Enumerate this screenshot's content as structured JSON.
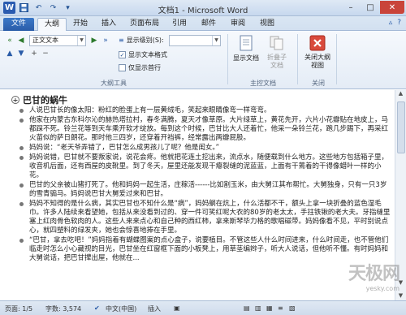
{
  "window": {
    "title": "文档1 - Microsoft Word"
  },
  "tabs": [
    {
      "label": "文件"
    },
    {
      "label": "大纲"
    },
    {
      "label": "开始"
    },
    {
      "label": "插入"
    },
    {
      "label": "页面布局"
    },
    {
      "label": "引用"
    },
    {
      "label": "邮件"
    },
    {
      "label": "审阅"
    },
    {
      "label": "视图"
    }
  ],
  "ribbon": {
    "outline_tools": {
      "level_value": "正文文本",
      "show_level_label": "显示级别(S):",
      "show_text_format_label": "显示文本格式",
      "show_first_line_label": "仅显示首行",
      "group_label": "大纲工具"
    },
    "master_doc": {
      "show_doc_label": "显示文档",
      "collapse_subdoc_label": "折叠子文档",
      "group_label": "主控文档"
    },
    "close": {
      "close_label": "关闭大纲视图",
      "group_label": "关闭"
    }
  },
  "document": {
    "heading": "巴甘的蜗牛",
    "paragraphs": [
      "人说巴甘长的像太阳：粉红的脸蛋上有一层黄绒毛，笑起来眼睛像弯一样弯弯。",
      "他家在内蒙古东科尔沁的赫热塔拉村，春冬满腾，夏天才像草原。大片绿草上，黄花先开，六片小花瓣贴在地皮上，马都踩不死。铃兰花等到天车乘开软才绽放。每到这个时候，巴甘比大人还着忙，他采一朵铃兰花，跑几步踢下，再采红火苗似的萨日朗花。那时他三四岁，还穿着开裆裤，经常露出两瓣屁股。",
      "妈妈说：“老天爷弄错了，巴甘怎么成男孩儿了呢？他是闺女。”",
      "妈妈说错，巴甘就不要叛家说，说花会疼。他就把花连土挖出来，流点水，随便载到什么地方。这些地方包括箱子里，收音机后面，还有西屋的皮靴里。到了冬天，屋里还能发现干瘪裂缝的泥蓝蓝，上面有干蔫着的干得像蜡叶一样的小花。",
      "巴甘的父亲被山猪打死了。他和妈妈一起生活，庄稼活------比如割玉米，由大舅江其布帮忙。大舅独身，只有一只3岁的雪青骟马。妈妈说巴甘大舅爱过来和巴甘。",
      "妈妈不知得的是什么病，其实巴甘也不知什么是“病”，妈妈躺在炕上，什么活都不干，额头上拿一块折叠的蓝色湿毛巾。许多人陆续来看望她，包括从来没看到过的、穿一件可笑红呢大衣的80岁的老太太，手拄铁锹的老大夫。牙指缝里塞上红肉骨色软肉的人。这些人来来点心和自己种的西红柿，拿来斯琴毕力格的歌唱磁带。妈妈像看不见，平时别说点心，就四塑料的绿发夹，她也会惊喜地捧在手里。",
      "“巴甘，拿去吃吧！”妈妈指着有蝴蝶图案的点心盒子，说要植目。不管这些人什么时间进来，什么时间走，也不管他们临走时怎么小心藏视的目光，巴甘坐在红窗框下面的小板凳上，用草茎编辫子，听大人说话，但他听不懂。有时妈妈和大舅说话，把巴甘撵出屋，他就在..."
    ]
  },
  "status_bar": {
    "page": "页面: 1/5",
    "word_count": "字数: 3,574",
    "language": "中文(中国)",
    "mode": "插入"
  },
  "watermark": {
    "text": "天极网",
    "sub": "yesky.com"
  }
}
